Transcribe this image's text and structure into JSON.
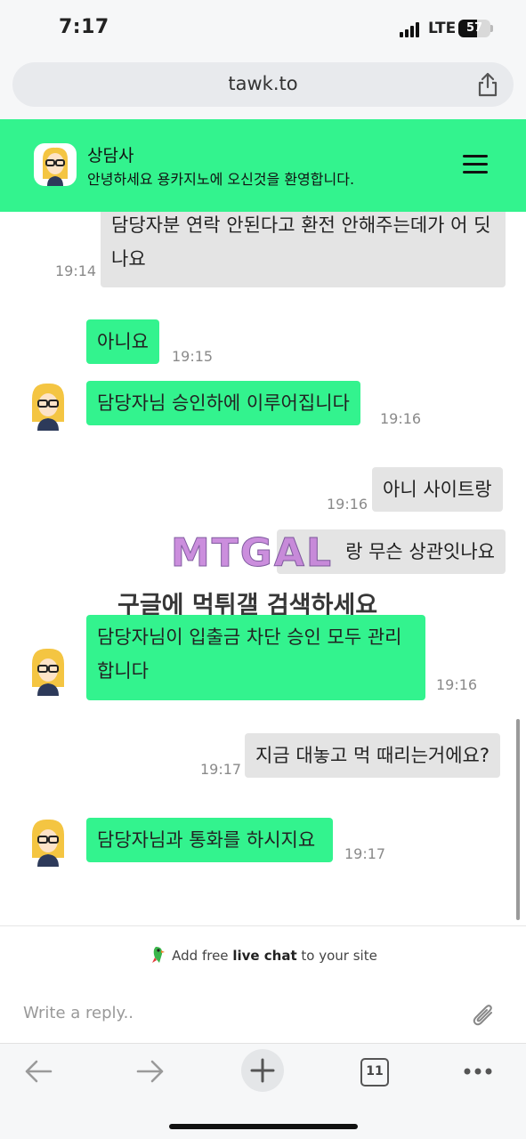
{
  "status_bar": {
    "time": "7:17",
    "network": "LTE",
    "battery": "57",
    "battery_level": 0.57
  },
  "browser": {
    "url": "tawk.to",
    "tab_count": "11"
  },
  "header": {
    "title": "상담사",
    "subtitle": "안녕하세요 용카지노에 오신것을 환영합니다."
  },
  "messages": [
    {
      "side": "out",
      "text": "담당자분 연락 안된다고 환전 안해주는데가 어 딧나요",
      "time": "19:14"
    },
    {
      "side": "in",
      "text": "아니요",
      "time": "19:15"
    },
    {
      "side": "in",
      "text": "담당자님 승인하에 이루어집니다",
      "time": "19:16"
    },
    {
      "side": "out",
      "text": "아니 사이트랑",
      "time": "19:16"
    },
    {
      "side": "out",
      "text": "랑 무슨 상관잇나요",
      "time": ""
    },
    {
      "side": "in",
      "text": "담당자님이 입출금 차단 승인 모두 관리 합니다",
      "time": "19:16"
    },
    {
      "side": "out",
      "text": "지금 대놓고 먹 때리는거에요?",
      "time": "19:17"
    },
    {
      "side": "in",
      "text": "담당자님과 통화를 하시지요",
      "time": "19:17"
    }
  ],
  "watermark": {
    "logo": "MTGAL",
    "text": "구글에 먹튀갤 검색하세요"
  },
  "footer": {
    "powered_prefix": "Add free ",
    "powered_bold": "live chat",
    "powered_suffix": " to your site",
    "reply_placeholder": "Write a reply.."
  },
  "colors": {
    "accent": "#33f38e",
    "outgoing_bubble": "#e4e4e4"
  }
}
